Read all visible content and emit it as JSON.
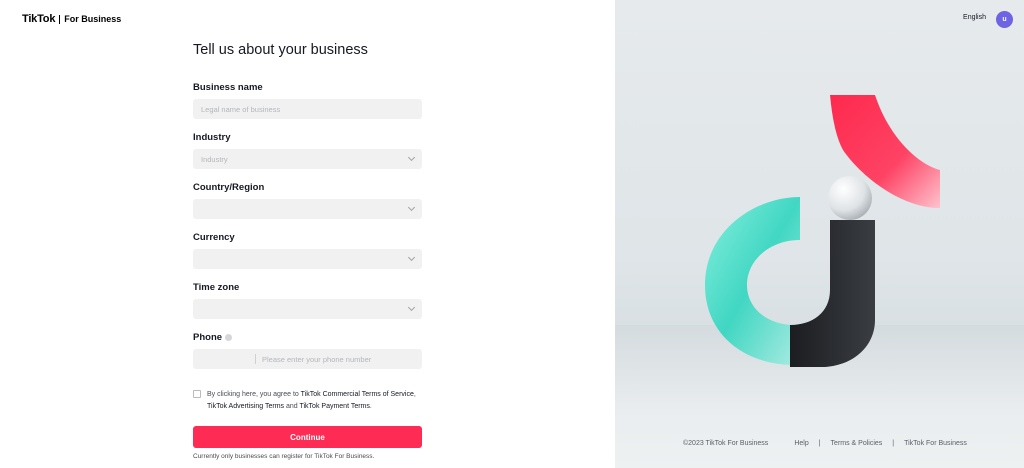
{
  "header": {
    "logo_main": "TikTok",
    "logo_sub": "For Business",
    "language": "English",
    "avatar_initial": "u"
  },
  "form": {
    "title": "Tell us about your business",
    "fields": [
      {
        "label": "Business name",
        "placeholder": "Legal name of business"
      },
      {
        "label": "Industry",
        "value": "Industry"
      },
      {
        "label": "Country/Region",
        "value": ""
      },
      {
        "label": "Currency",
        "value": ""
      },
      {
        "label": "Time zone",
        "value": ""
      },
      {
        "label": "Phone",
        "placeholder": "Please enter your phone number"
      }
    ],
    "agree": {
      "prefix": "By clicking here, you agree to ",
      "link1": "TikTok Commercial Terms of Service",
      "comma": ",",
      "link2": "TikTok Advertising Terms",
      "and": " and ",
      "link3": "TikTok Payment Terms",
      "end": "."
    },
    "continue_label": "Continue",
    "note": "Currently only businesses can register for TikTok For Business."
  },
  "footer": {
    "copyright": "©2023 TikTok For Business",
    "links": [
      "Help",
      "Terms & Policies",
      "TikTok For Business"
    ],
    "separator": "|"
  },
  "colors": {
    "accent": "#fe2c55",
    "avatar": "#6e63e3",
    "teal": "#3ed8c3",
    "red": "#ff2d4f"
  }
}
